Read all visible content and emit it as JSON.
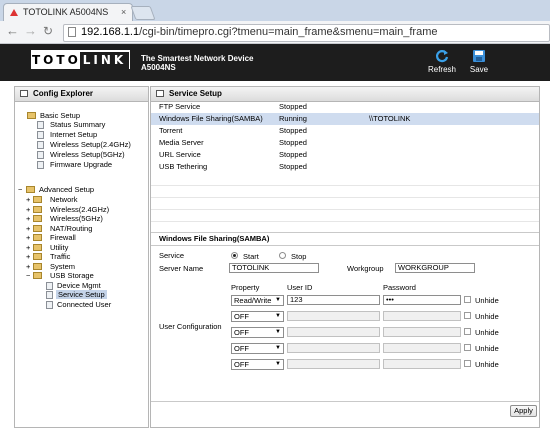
{
  "browser": {
    "tab_title": "TOTOLINK A5004NS",
    "tab_close": "×",
    "url_host": "192.168.1.1",
    "url_path": "/cgi-bin/timepro.cgi?tmenu=main_frame&smenu=main_frame"
  },
  "header": {
    "logo_left": "TOTO",
    "logo_right": "LINK",
    "tagline": "The Smartest Network Device",
    "model": "A5004NS",
    "refresh_label": "Refresh",
    "save_label": "Save"
  },
  "sidebar": {
    "title": "Config Explorer",
    "basic": {
      "label": "Basic Setup",
      "items": [
        "Status Summary",
        "Internet Setup",
        "Wireless Setup(2.4GHz)",
        "Wireless Setup(5GHz)",
        "Firmware Upgrade"
      ]
    },
    "advanced": {
      "label": "Advanced Setup",
      "items": [
        "Network",
        "Wireless(2.4GHz)",
        "Wireless(5GHz)",
        "NAT/Routing",
        "Firewall",
        "Utility",
        "Traffic",
        "System",
        "USB Storage"
      ],
      "usb_items": [
        "Device Mgmt",
        "Service Setup",
        "Connected User"
      ],
      "selected": "Service Setup"
    }
  },
  "main": {
    "title": "Service Setup",
    "services": [
      {
        "name": "FTP Service",
        "status": "Stopped",
        "extra": ""
      },
      {
        "name": "Windows File Sharing(SAMBA)",
        "status": "Running",
        "extra": "\\\\TOTOLINK"
      },
      {
        "name": "Torrent",
        "status": "Stopped",
        "extra": ""
      },
      {
        "name": "Media Server",
        "status": "Stopped",
        "extra": ""
      },
      {
        "name": "URL Service",
        "status": "Stopped",
        "extra": ""
      },
      {
        "name": "USB Tethering",
        "status": "Stopped",
        "extra": ""
      }
    ],
    "samba": {
      "title": "Windows File Sharing(SAMBA)",
      "service_label": "Service",
      "start_label": "Start",
      "stop_label": "Stop",
      "service_value": "Start",
      "server_name_label": "Server Name",
      "server_name": "TOTOLINK",
      "workgroup_label": "Workgroup",
      "workgroup": "WORKGROUP",
      "user_config_label": "User Configuration",
      "col_property": "Property",
      "col_user_id": "User ID",
      "col_password": "Password",
      "unhide_label": "Unhide",
      "users": [
        {
          "property": "Read/Write",
          "user_id": "123",
          "password": "•••"
        },
        {
          "property": "OFF",
          "user_id": "",
          "password": ""
        },
        {
          "property": "OFF",
          "user_id": "",
          "password": ""
        },
        {
          "property": "OFF",
          "user_id": "",
          "password": ""
        },
        {
          "property": "OFF",
          "user_id": "",
          "password": ""
        }
      ]
    },
    "apply_label": "Apply"
  }
}
